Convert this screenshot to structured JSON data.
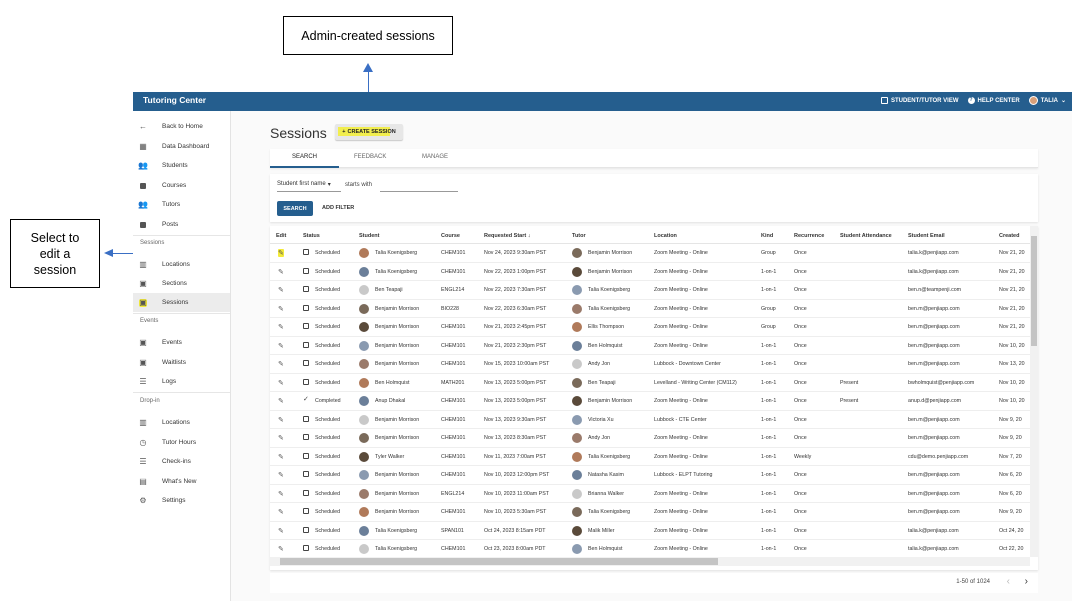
{
  "annotations": {
    "top_callout": "Admin-created sessions",
    "left_callout": "Select to edit a session"
  },
  "topbar": {
    "title": "Tutoring Center",
    "student_view": "STUDENT/TUTOR VIEW",
    "help": "HELP CENTER",
    "user": "TALIA"
  },
  "sidebar": {
    "back": "Back to Home",
    "data_dashboard": "Data Dashboard",
    "students": "Students",
    "courses": "Courses",
    "tutors": "Tutors",
    "posts": "Posts",
    "sessions_head": "Sessions",
    "locations": "Locations",
    "sections": "Sections",
    "sessions": "Sessions",
    "events_head": "Events",
    "events": "Events",
    "waitlists": "Waitlists",
    "logs": "Logs",
    "dropin_head": "Drop-in",
    "dropin_locations": "Locations",
    "tutor_hours": "Tutor Hours",
    "check_ins": "Check-ins",
    "whats_new": "What's New",
    "settings": "Settings"
  },
  "page": {
    "title": "Sessions",
    "create_label": "CREATE SESSION"
  },
  "tabs": [
    "SEARCH",
    "FEEDBACK",
    "MANAGE"
  ],
  "search": {
    "field": "Student first name",
    "operator": "starts with",
    "search_btn": "SEARCH",
    "filter_btn": "ADD FILTER"
  },
  "table": {
    "headers": [
      "Edit",
      "Status",
      "Student",
      "Course",
      "Requested Start",
      "Tutor",
      "Location",
      "Kind",
      "Recurrence",
      "Student Attendance",
      "Student Email",
      "Created"
    ],
    "rows": [
      {
        "status": "Scheduled",
        "student": "Talia Koenigsberg",
        "course": "CHEM101",
        "start": "Nov 24, 2023 9:30am PST",
        "tutor": "Benjamin Morrison",
        "location": "Zoom Meeting - Online",
        "kind": "Group",
        "rec": "Once",
        "att": "",
        "email": "talia.k@penjiapp.com",
        "created": "Nov 21, 20"
      },
      {
        "status": "Scheduled",
        "student": "Talia Koenigsberg",
        "course": "CHEM101",
        "start": "Nov 22, 2023 1:00pm PST",
        "tutor": "Benjamin Morrison",
        "location": "Zoom Meeting - Online",
        "kind": "1-on-1",
        "rec": "Once",
        "att": "",
        "email": "talia.k@penjiapp.com",
        "created": "Nov 21, 20"
      },
      {
        "status": "Scheduled",
        "student": "Ben Teapaji",
        "course": "ENGL214",
        "start": "Nov 22, 2023 7:30am PST",
        "tutor": "Talia Koenigsberg",
        "location": "Zoom Meeting - Online",
        "kind": "1-on-1",
        "rec": "Once",
        "att": "",
        "email": "ben.n@teampenji.com",
        "created": "Nov 21, 20"
      },
      {
        "status": "Scheduled",
        "student": "Benjamin Morrison",
        "course": "BIO228",
        "start": "Nov 22, 2023 6:30am PST",
        "tutor": "Talia Koenigsberg",
        "location": "Zoom Meeting - Online",
        "kind": "Group",
        "rec": "Once",
        "att": "",
        "email": "ben.m@penjiapp.com",
        "created": "Nov 21, 20"
      },
      {
        "status": "Scheduled",
        "student": "Benjamin Morrison",
        "course": "CHEM101",
        "start": "Nov 21, 2023 2:45pm PST",
        "tutor": "Ellis Thompson",
        "location": "Zoom Meeting - Online",
        "kind": "Group",
        "rec": "Once",
        "att": "",
        "email": "ben.m@penjiapp.com",
        "created": "Nov 21, 20"
      },
      {
        "status": "Scheduled",
        "student": "Benjamin Morrison",
        "course": "CHEM101",
        "start": "Nov 21, 2023 2:30pm PST",
        "tutor": "Ben Holmquist",
        "location": "Zoom Meeting - Online",
        "kind": "1-on-1",
        "rec": "Once",
        "att": "",
        "email": "ben.m@penjiapp.com",
        "created": "Nov 10, 20"
      },
      {
        "status": "Scheduled",
        "student": "Benjamin Morrison",
        "course": "CHEM101",
        "start": "Nov 15, 2023 10:00am PST",
        "tutor": "Andy Jon",
        "location": "Lubbock - Downtown Center",
        "kind": "1-on-1",
        "rec": "Once",
        "att": "",
        "email": "ben.m@penjiapp.com",
        "created": "Nov 13, 20"
      },
      {
        "status": "Scheduled",
        "student": "Ben Holmquist",
        "course": "MATH201",
        "start": "Nov 13, 2023 5:00pm PST",
        "tutor": "Ben Teapaji",
        "location": "Levelland - Writing Center (CM112)",
        "kind": "1-on-1",
        "rec": "Once",
        "att": "Present",
        "email": "bwholmquist@penjiapp.com",
        "created": "Nov 10, 20"
      },
      {
        "status": "Completed",
        "student": "Anup Dhakal",
        "course": "CHEM101",
        "start": "Nov 13, 2023 5:00pm PST",
        "tutor": "Benjamin Morrison",
        "location": "Zoom Meeting - Online",
        "kind": "1-on-1",
        "rec": "Once",
        "att": "Present",
        "email": "anup.d@penjiapp.com",
        "created": "Nov 10, 20"
      },
      {
        "status": "Scheduled",
        "student": "Benjamin Morrison",
        "course": "CHEM101",
        "start": "Nov 13, 2023 9:30am PST",
        "tutor": "Victoria Xu",
        "location": "Lubbock - CTE Center",
        "kind": "1-on-1",
        "rec": "Once",
        "att": "",
        "email": "ben.m@penjiapp.com",
        "created": "Nov 9, 20"
      },
      {
        "status": "Scheduled",
        "student": "Benjamin Morrison",
        "course": "CHEM101",
        "start": "Nov 13, 2023 8:30am PST",
        "tutor": "Andy Jon",
        "location": "Zoom Meeting - Online",
        "kind": "1-on-1",
        "rec": "Once",
        "att": "",
        "email": "ben.m@penjiapp.com",
        "created": "Nov 9, 20"
      },
      {
        "status": "Scheduled",
        "student": "Tyler Walker",
        "course": "CHEM101",
        "start": "Nov 11, 2023 7:00am PST",
        "tutor": "Talia Koenigsberg",
        "location": "Zoom Meeting - Online",
        "kind": "1-on-1",
        "rec": "Weekly",
        "att": "",
        "email": "cdu@demo.penjiapp.com",
        "created": "Nov 7, 20"
      },
      {
        "status": "Scheduled",
        "student": "Benjamin Morrison",
        "course": "CHEM101",
        "start": "Nov 10, 2023 12:00pm PST",
        "tutor": "Natasha Kasim",
        "location": "Lubbock - ELPT Tutoring",
        "kind": "1-on-1",
        "rec": "Once",
        "att": "",
        "email": "ben.m@penjiapp.com",
        "created": "Nov 6, 20"
      },
      {
        "status": "Scheduled",
        "student": "Benjamin Morrison",
        "course": "ENGL214",
        "start": "Nov 10, 2023 11:00am PST",
        "tutor": "Brianna Walker",
        "location": "Zoom Meeting - Online",
        "kind": "1-on-1",
        "rec": "Once",
        "att": "",
        "email": "ben.m@penjiapp.com",
        "created": "Nov 6, 20"
      },
      {
        "status": "Scheduled",
        "student": "Benjamin Morrison",
        "course": "CHEM101",
        "start": "Nov 10, 2023 5:30am PST",
        "tutor": "Talia Koenigsberg",
        "location": "Zoom Meeting - Online",
        "kind": "1-on-1",
        "rec": "Once",
        "att": "",
        "email": "ben.m@penjiapp.com",
        "created": "Nov 9, 20"
      },
      {
        "status": "Scheduled",
        "student": "Talia Koenigsberg",
        "course": "SPAN101",
        "start": "Oct 24, 2023 8:15am PDT",
        "tutor": "Malik Miller",
        "location": "Zoom Meeting - Online",
        "kind": "1-on-1",
        "rec": "Once",
        "att": "",
        "email": "talia.k@penjiapp.com",
        "created": "Oct 24, 20"
      },
      {
        "status": "Scheduled",
        "student": "Talia Koenigsberg",
        "course": "CHEM101",
        "start": "Oct 23, 2023 8:00am PDT",
        "tutor": "Ben Holmquist",
        "location": "Zoom Meeting - Online",
        "kind": "1-on-1",
        "rec": "Once",
        "att": "",
        "email": "talia.k@penjiapp.com",
        "created": "Oct 22, 20"
      }
    ]
  },
  "pager": {
    "range": "1-50 of 1024"
  },
  "colors": {
    "brand": "#255e8e",
    "highlight": "#f3ea3a",
    "arrow": "#3a6fc4"
  }
}
